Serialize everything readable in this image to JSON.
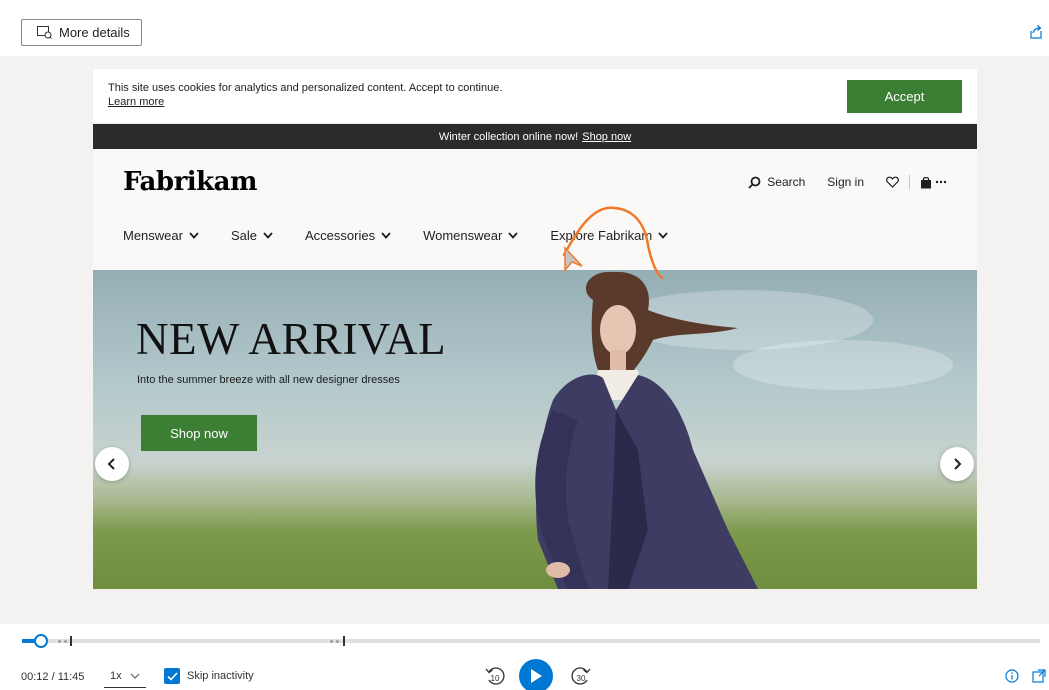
{
  "toolbar": {
    "more_details_label": "More details"
  },
  "cookie_banner": {
    "message": "This site uses cookies for analytics and personalized content. Accept to continue.",
    "learn_more": "Learn more",
    "accept_label": "Accept"
  },
  "promo": {
    "text": "Winter collection online now!",
    "link": "Shop now"
  },
  "header": {
    "logo": "Fabrikam",
    "search_label": "Search",
    "sign_in_label": "Sign in",
    "nav": [
      "Menswear",
      "Sale",
      "Accessories",
      "Womenswear",
      "Explore Fabrikam"
    ]
  },
  "hero": {
    "title": "NEW ARRIVAL",
    "subtitle": "Into the summer breeze with all new designer dresses",
    "cta": "Shop now"
  },
  "player": {
    "time": "00:12 / 11:45",
    "speed": "1x",
    "skip_inactivity_label": "Skip inactivity",
    "skip_inactivity_checked": true,
    "progress_fraction": 0.017,
    "rewind_seconds": "10",
    "forward_seconds": "30"
  },
  "colors": {
    "accent": "#0078d4",
    "brand_green": "#3c7e34",
    "promo_bar": "#2b2b2b",
    "annotation": "#f07a2a"
  }
}
